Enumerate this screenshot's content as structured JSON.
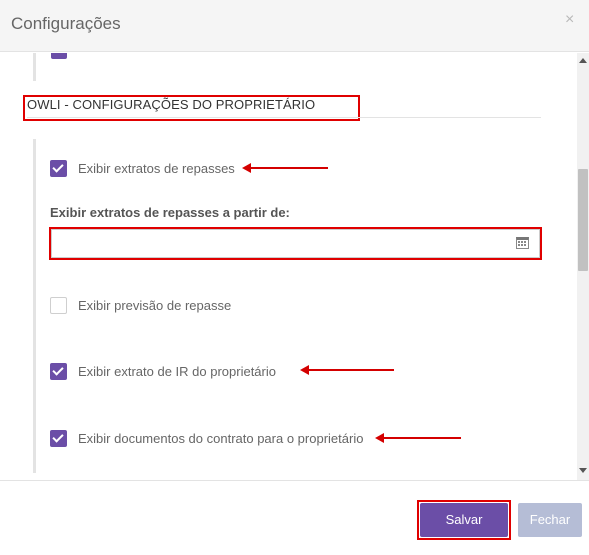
{
  "header": {
    "title": "Configurações",
    "close_glyph": "×"
  },
  "section": {
    "title": "OWLI - CONFIGURAÇÕES DO PROPRIETÁRIO"
  },
  "options": {
    "extratos_repasses": {
      "label": "Exibir extratos de repasses",
      "checked": true
    },
    "previsao_repasse": {
      "label": "Exibir previsão de repasse",
      "checked": false
    },
    "extrato_ir": {
      "label": "Exibir extrato de IR do proprietário",
      "checked": true
    },
    "documentos_contrato": {
      "label": "Exibir documentos do contrato para o proprietário",
      "checked": true
    }
  },
  "date_field": {
    "label": "Exibir extratos de repasses a partir de:",
    "value": "",
    "icon": "calendar-icon"
  },
  "footer": {
    "save_label": "Salvar",
    "close_label": "Fechar"
  },
  "colors": {
    "accent": "#6b4ea7",
    "annotation_red": "#e00000",
    "disabled_button": "#b5bdd6"
  }
}
